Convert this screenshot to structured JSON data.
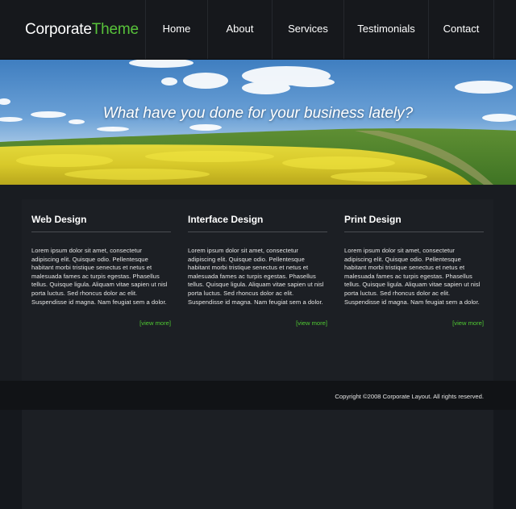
{
  "logo": {
    "main": "Corporate",
    "accent": "Theme"
  },
  "nav": {
    "items": [
      {
        "label": "Home"
      },
      {
        "label": "About"
      },
      {
        "label": "Services"
      },
      {
        "label": "Testimonials"
      },
      {
        "label": "Contact"
      }
    ]
  },
  "banner": {
    "tagline": "What have you done for your business lately?"
  },
  "columns": [
    {
      "title": "Web Design",
      "body": "Lorem ipsum dolor sit amet, consectetur adipiscing elit. Quisque odio. Pellentesque habitant morbi tristique senectus et netus et malesuada fames ac turpis egestas. Phasellus tellus. Quisque ligula. Aliquam vitae sapien ut nisl porta luctus. Sed rhoncus dolor ac elit. Suspendisse id magna. Nam feugiat sem a dolor.",
      "link": "[view more]"
    },
    {
      "title": "Interface Design",
      "body": "Lorem ipsum dolor sit amet, consectetur adipiscing elit. Quisque odio. Pellentesque habitant morbi tristique senectus et netus et malesuada fames ac turpis egestas. Phasellus tellus. Quisque ligula. Aliquam vitae sapien ut nisl porta luctus. Sed rhoncus dolor ac elit. Suspendisse id magna. Nam feugiat sem a dolor.",
      "link": "[view more]"
    },
    {
      "title": "Print Design",
      "body": "Lorem ipsum dolor sit amet, consectetur adipiscing elit. Quisque odio. Pellentesque habitant morbi tristique senectus et netus et malesuada fames ac turpis egestas. Phasellus tellus. Quisque ligula. Aliquam vitae sapien ut nisl porta luctus. Sed rhoncus dolor ac elit. Suspendisse id magna. Nam feugiat sem a dolor.",
      "link": "[view more]"
    }
  ],
  "footer": {
    "copyright": "Copyright ©2008 Corporate Layout. All rights reserved."
  },
  "colors": {
    "accent": "#58c23a",
    "link": "#4fc832",
    "background": "#15181d"
  }
}
